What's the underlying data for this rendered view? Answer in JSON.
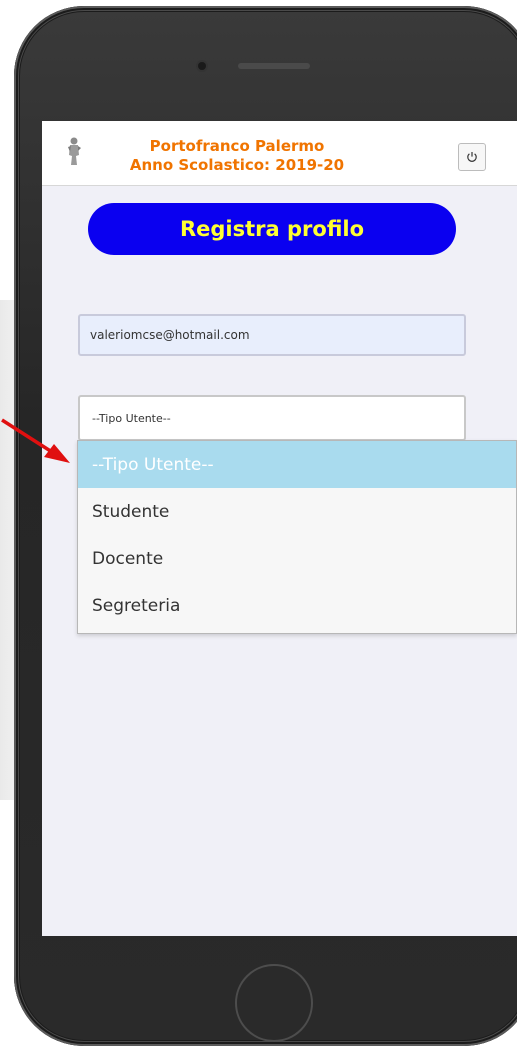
{
  "header": {
    "title_line1": "Portofranco Palermo",
    "title_line2": "Anno Scolastico: 2019-20"
  },
  "register_button": {
    "label": "Registra profilo"
  },
  "email_field": {
    "value": "valeriomcse@hotmail.com"
  },
  "user_type_select": {
    "selected": "--Tipo Utente--",
    "options": [
      "--Tipo Utente--",
      "Studente",
      "Docente",
      "Segreteria"
    ]
  },
  "icons": {
    "logo": "statue-logo-icon",
    "power": "power-icon",
    "pointer": "red-arrow-icon"
  },
  "colors": {
    "title": "#f07400",
    "button_bg": "#0a00f0",
    "button_text": "#ffff33",
    "highlight": "#a9dbee",
    "arrow": "#e01010"
  }
}
